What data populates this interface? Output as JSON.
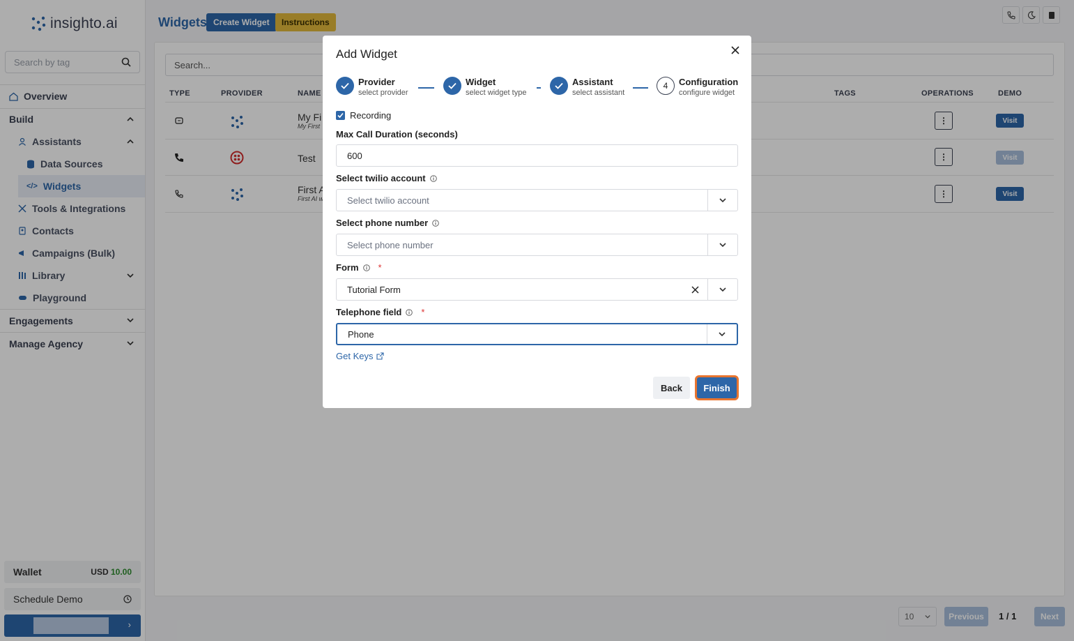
{
  "brand": {
    "name": "insighto.ai"
  },
  "sidebar": {
    "search_placeholder": "Search by tag",
    "overview": "Overview",
    "build": "Build",
    "assistants": "Assistants",
    "data_sources": "Data Sources",
    "widgets": "Widgets",
    "tools": "Tools & Integrations",
    "contacts": "Contacts",
    "campaigns": "Campaigns (Bulk)",
    "library": "Library",
    "playground": "Playground",
    "engagements": "Engagements",
    "manage_agency": "Manage Agency",
    "wallet_label": "Wallet",
    "wallet_currency": "USD",
    "wallet_amount": "10.00",
    "schedule_demo": "Schedule Demo"
  },
  "header": {
    "title": "Widgets",
    "create_button": "Create Widget",
    "instructions_button": "Instructions"
  },
  "table": {
    "search_placeholder": "Search...",
    "columns": [
      "TYPE",
      "PROVIDER",
      "NAME",
      "TAGS",
      "OPERATIONS",
      "DEMO"
    ],
    "rows": [
      {
        "name": "My Fi",
        "sub": "My First",
        "visit": "Visit"
      },
      {
        "name": "Test",
        "sub": "",
        "visit": "Visit"
      },
      {
        "name": "First A",
        "sub": "First AI w",
        "visit": "Visit"
      }
    ]
  },
  "pagination": {
    "page_size": "10",
    "previous": "Previous",
    "current": "1",
    "sep": "/",
    "total": "1",
    "next": "Next"
  },
  "modal": {
    "title": "Add Widget",
    "steps": [
      {
        "title": "Provider",
        "subtitle": "select provider"
      },
      {
        "title": "Widget",
        "subtitle": "select widget type"
      },
      {
        "title": "Assistant",
        "subtitle": "select assistant"
      },
      {
        "title": "Configuration",
        "subtitle": "configure widget",
        "number": "4"
      }
    ],
    "recording_label": "Recording",
    "max_duration_label": "Max Call Duration (seconds)",
    "max_duration_value": "600",
    "twilio_label": "Select twilio account",
    "twilio_placeholder": "Select twilio account",
    "phone_label": "Select phone number",
    "phone_placeholder": "Select phone number",
    "form_label": "Form",
    "form_value": "Tutorial Form",
    "telephone_label": "Telephone field",
    "telephone_value": "Phone",
    "required_mark": "*",
    "get_keys": "Get Keys",
    "back": "Back",
    "finish": "Finish"
  },
  "colors": {
    "primary": "#2d66a8",
    "accent": "#e2b93b",
    "focus_ring": "#e8752f"
  }
}
